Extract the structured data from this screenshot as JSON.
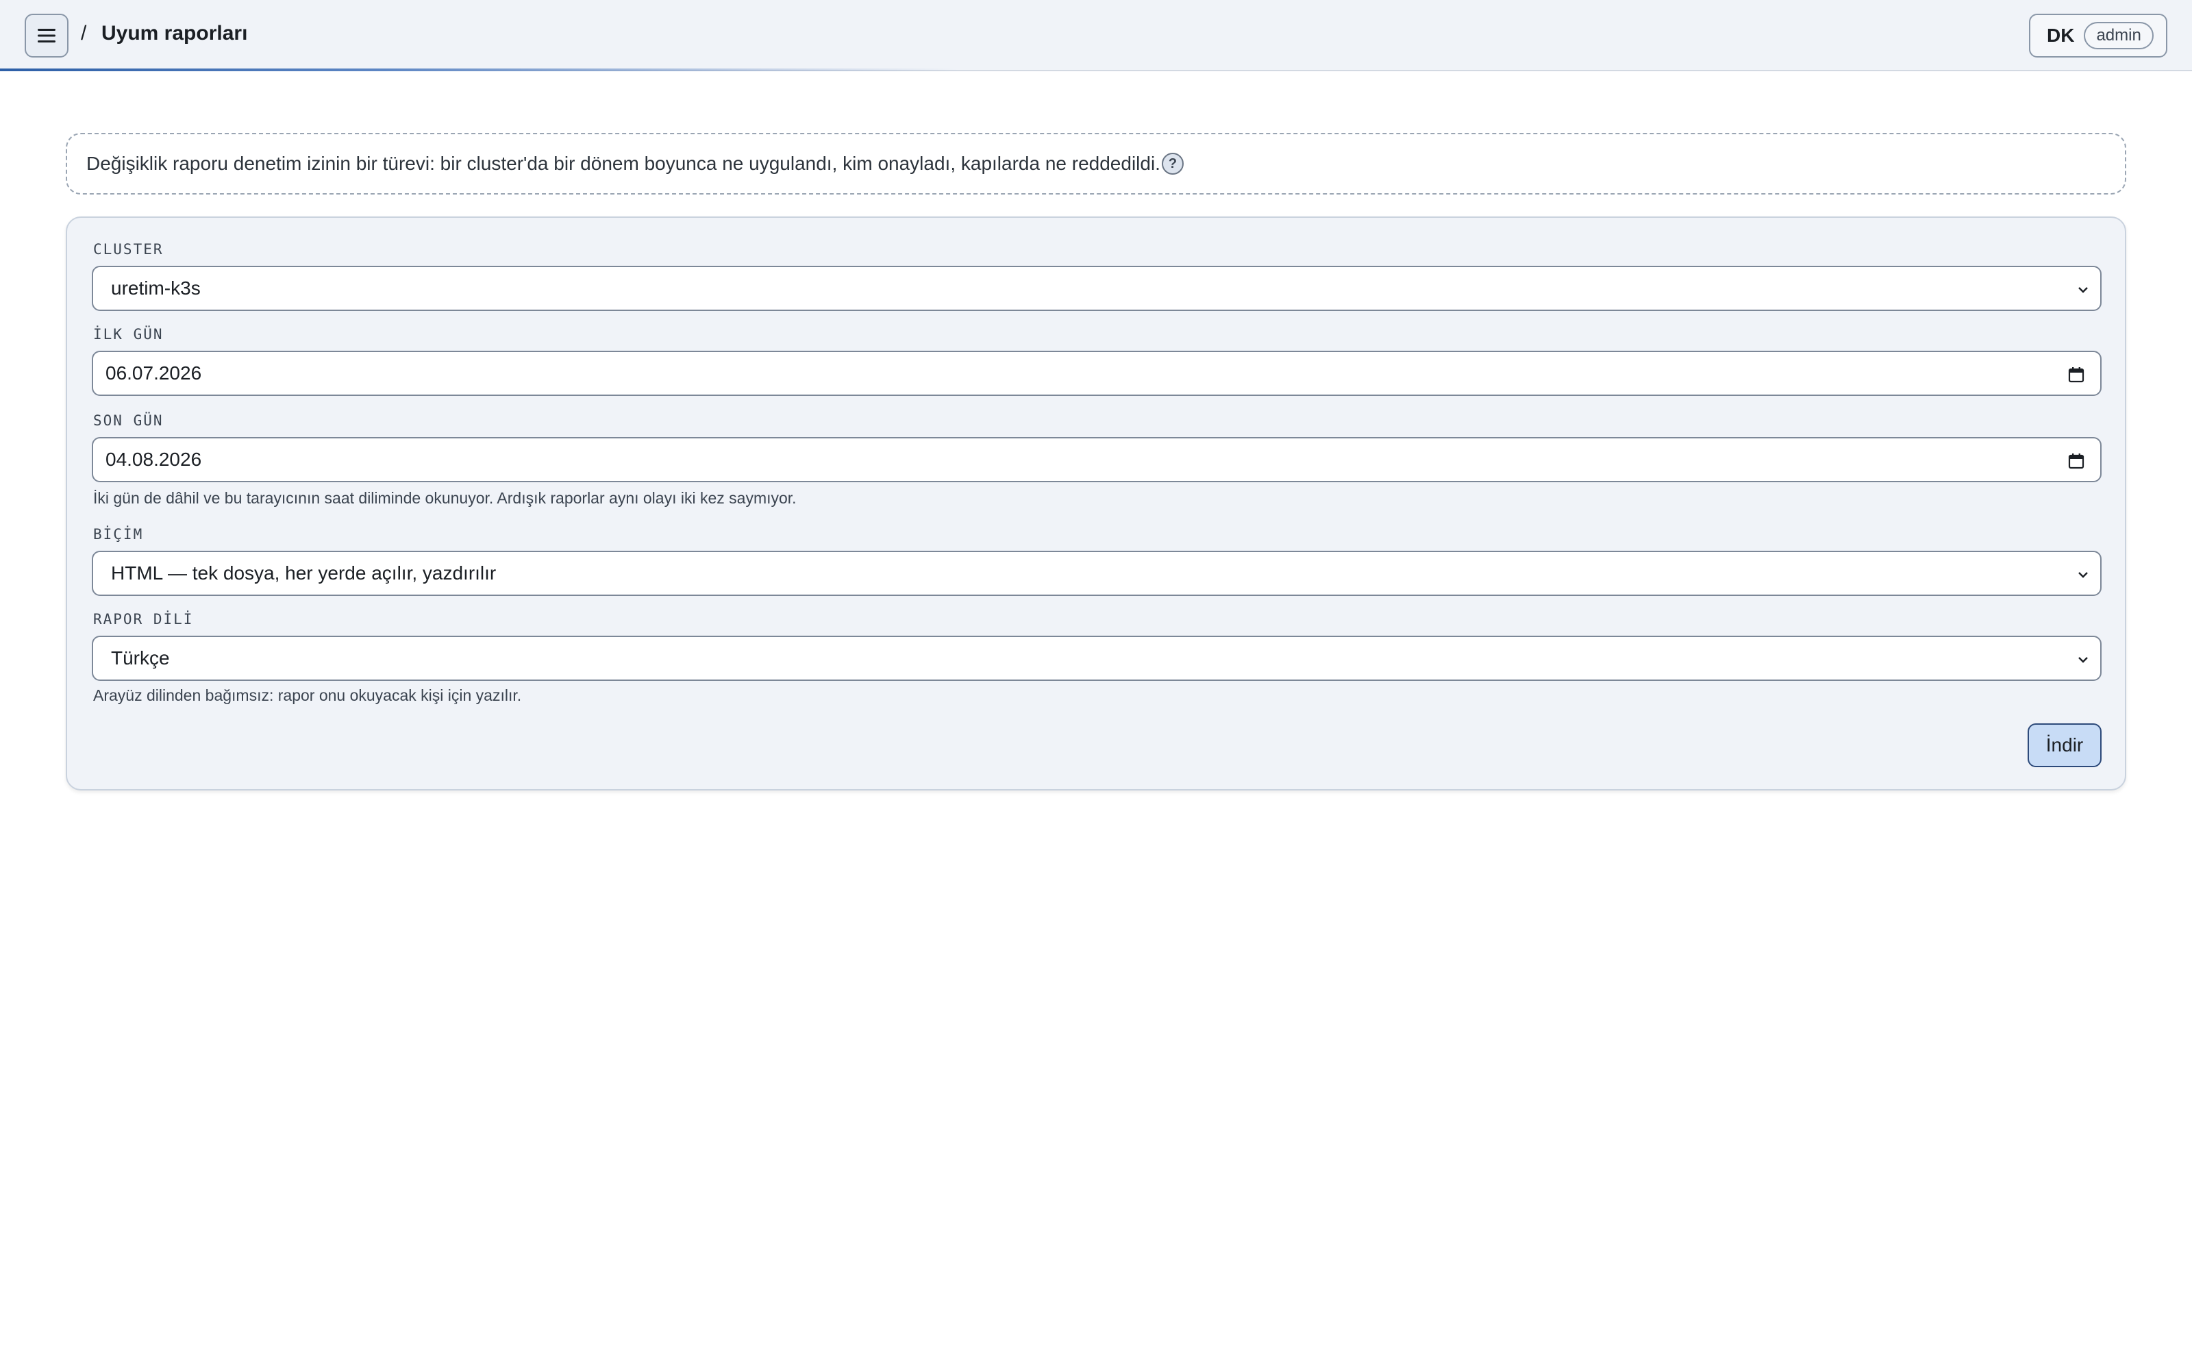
{
  "header": {
    "breadcrumb_separator": "/",
    "page_title": "Uyum raporları",
    "user_initials": "DK",
    "user_role": "admin"
  },
  "info": {
    "text": "Değişiklik raporu denetim izinin bir türevi: bir cluster'da bir dönem boyunca ne uygulandı, kim onayladı, kapılarda ne reddedildi.",
    "help_glyph": "?"
  },
  "form": {
    "cluster": {
      "label": "CLUSTER",
      "value": "uretim-k3s"
    },
    "first_day": {
      "label": "İLK GÜN",
      "value": "06.07.2026"
    },
    "last_day": {
      "label": "SON GÜN",
      "value": "04.08.2026",
      "hint": "İki gün de dâhil ve bu tarayıcının saat diliminde okunuyor. Ardışık raporlar aynı olayı iki kez saymıyor."
    },
    "format": {
      "label": "BİÇİM",
      "value": "HTML — tek dosya, her yerde açılır, yazdırılır"
    },
    "report_language": {
      "label": "RAPOR DİLİ",
      "value": "Türkçe",
      "hint": "Arayüz dilinden bağımsız: rapor onu okuyacak kişi için yazılır."
    },
    "download_label": "İndir"
  },
  "icons": {
    "menu": "hamburger-menu-icon",
    "help": "question-icon",
    "select": "chevron-down-icon",
    "date": "calendar-icon"
  },
  "colors": {
    "topbar_bg": "#f0f3f8",
    "accent": "#2d5fa7",
    "card_bg": "#f0f3f8",
    "button_bg": "#c8dcf6"
  }
}
